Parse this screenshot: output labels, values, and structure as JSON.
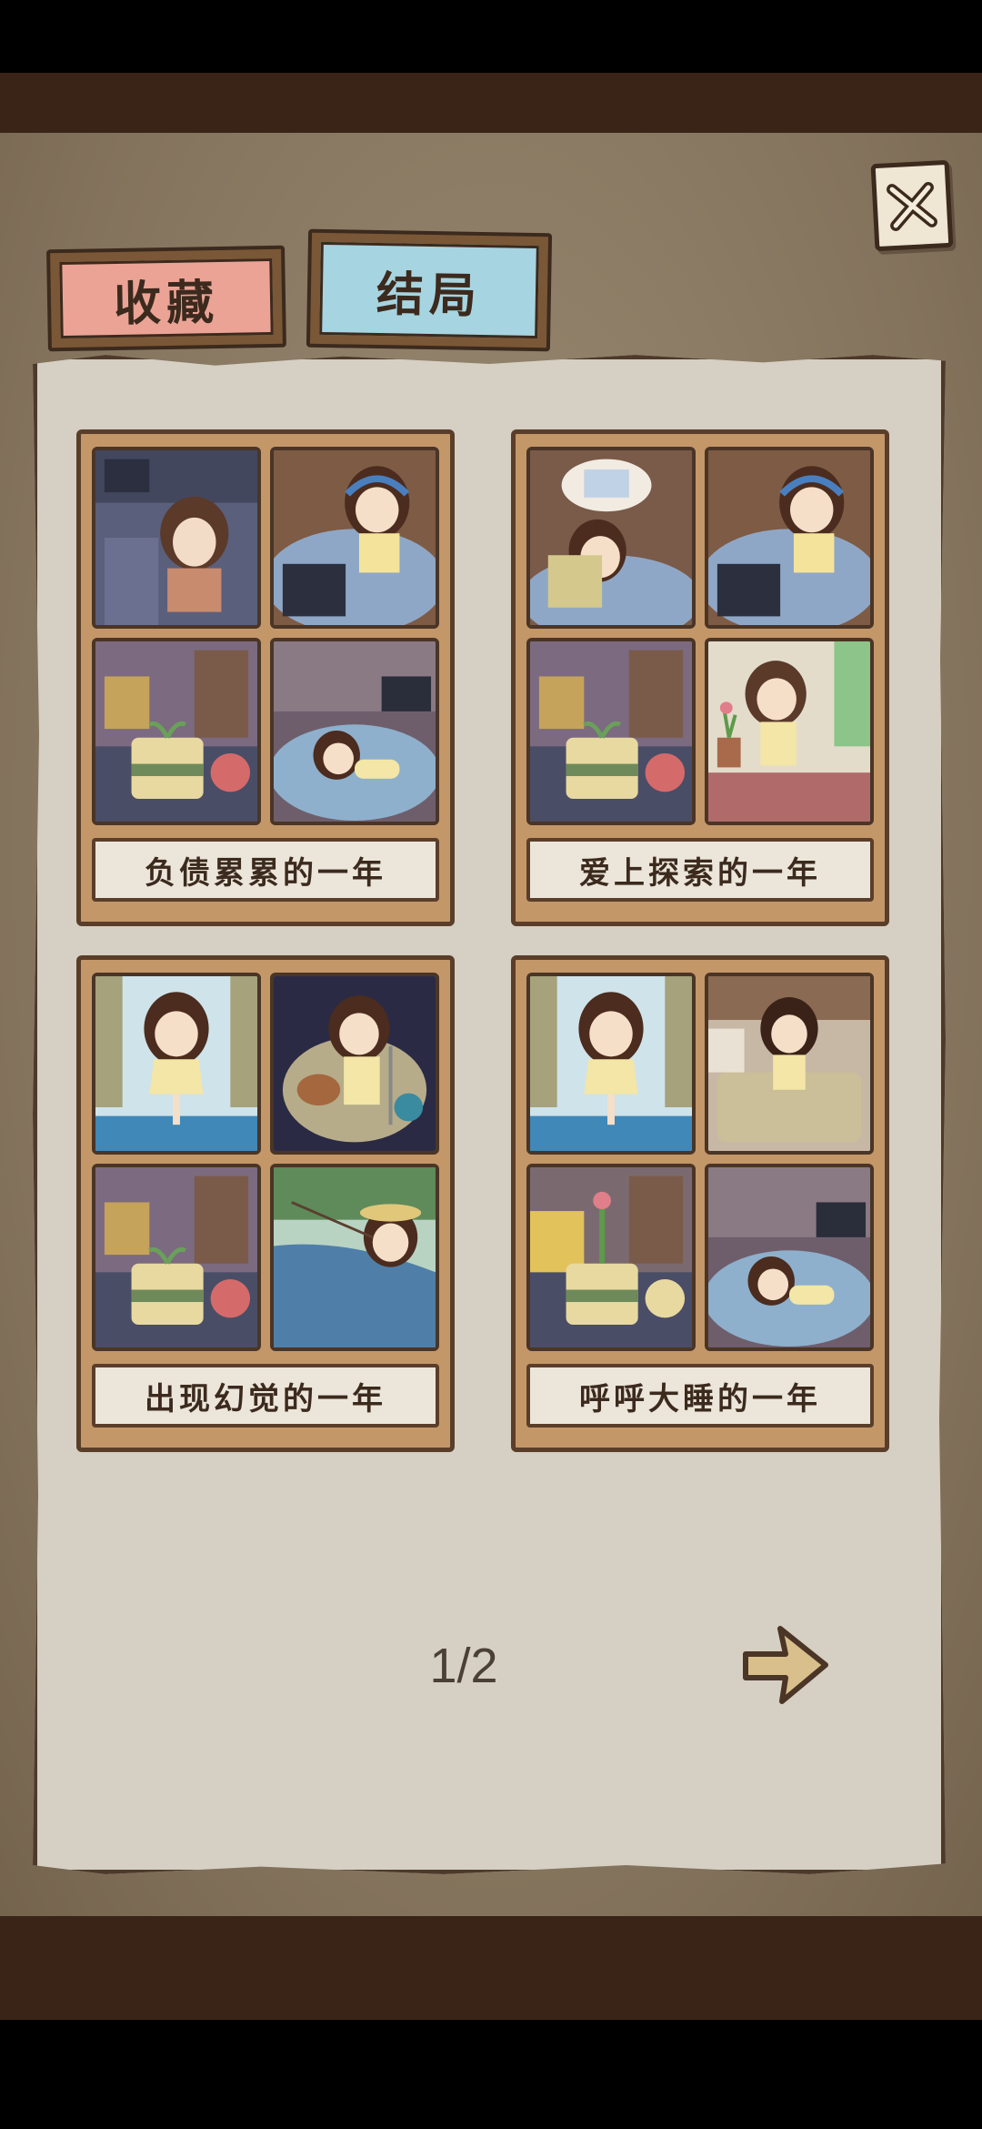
{
  "tabs": [
    {
      "label": "收藏",
      "selected": false
    },
    {
      "label": "结局",
      "selected": true
    }
  ],
  "close_icon": "close-x-icon",
  "endings": [
    {
      "title": "负债累累的一年",
      "panels": [
        "computer-room-sad-girl",
        "gamer-girl-headphones",
        "plant-pot-life",
        "girl-lying-on-rug"
      ]
    },
    {
      "title": "爱上探索的一年",
      "panels": [
        "girl-sleeping-thought-bubble",
        "gamer-girl-headphones",
        "plant-pot-life",
        "girl-watering-plants"
      ]
    },
    {
      "title": "出现幻觉的一年",
      "panels": [
        "girl-yoga-pose",
        "girl-singing-guitar",
        "plant-pot-life",
        "girl-fishing-pond"
      ]
    },
    {
      "title": "呼呼大睡的一年",
      "panels": [
        "girl-yoga-pose",
        "girl-meditating-bed",
        "flower-pot-life",
        "girl-lying-on-rug"
      ]
    }
  ],
  "pagination": {
    "current": "1/2"
  },
  "next_icon": "arrow-right-icon",
  "colors": {
    "tab_collect": "#eba395",
    "tab_ending": "#a7d4e1",
    "paper": "#d6cfc3",
    "frame": "#c49769"
  }
}
